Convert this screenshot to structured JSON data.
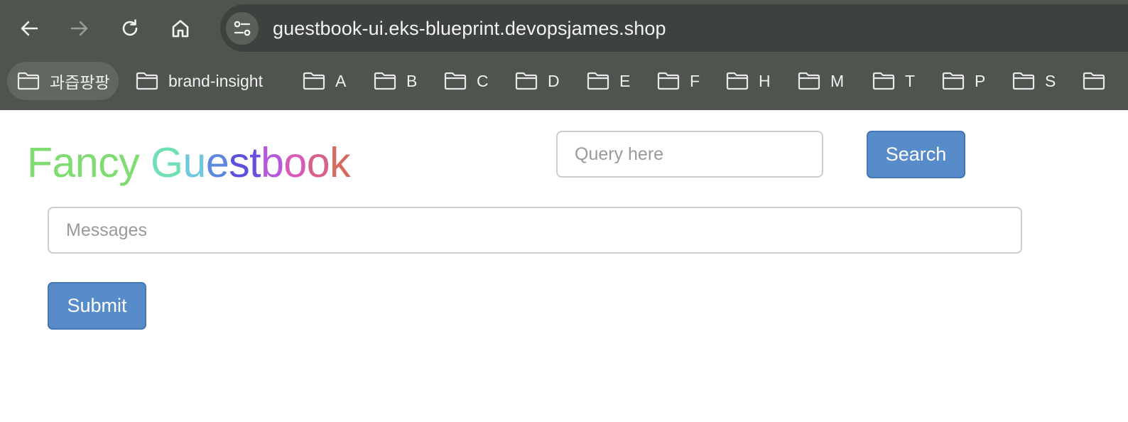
{
  "browser": {
    "url": "guestbook-ui.eks-blueprint.devopsjames.shop",
    "bookmarks": [
      {
        "label": "과즙팡팡"
      },
      {
        "label": "brand-insight"
      },
      {
        "label": "A"
      },
      {
        "label": "B"
      },
      {
        "label": "C"
      },
      {
        "label": "D"
      },
      {
        "label": "E"
      },
      {
        "label": "F"
      },
      {
        "label": "H"
      },
      {
        "label": "M"
      },
      {
        "label": "T"
      },
      {
        "label": "P"
      },
      {
        "label": "S"
      },
      {
        "label": ""
      }
    ],
    "icons": {
      "back": "back-arrow-icon",
      "forward": "forward-arrow-icon",
      "reload": "reload-icon",
      "home": "home-icon",
      "site_info": "tune-icon",
      "folder": "folder-icon"
    }
  },
  "page": {
    "title_letters": [
      {
        "ch": "F",
        "color": "#7fdc71"
      },
      {
        "ch": "a",
        "color": "#7fdc71"
      },
      {
        "ch": "n",
        "color": "#7fdc71"
      },
      {
        "ch": "c",
        "color": "#7fdc71"
      },
      {
        "ch": "y",
        "color": "#7fdc71"
      },
      {
        "ch": " ",
        "color": "#7fdc71"
      },
      {
        "ch": "G",
        "color": "#70dfb4"
      },
      {
        "ch": "u",
        "color": "#6fc9de"
      },
      {
        "ch": "e",
        "color": "#5e88de"
      },
      {
        "ch": "s",
        "color": "#5b52d9"
      },
      {
        "ch": "t",
        "color": "#6b4fdc"
      },
      {
        "ch": "b",
        "color": "#b65adb"
      },
      {
        "ch": "o",
        "color": "#d85ab6"
      },
      {
        "ch": "o",
        "color": "#d8618a"
      },
      {
        "ch": "k",
        "color": "#d66a5e"
      }
    ],
    "search": {
      "placeholder": "Query here",
      "button_label": "Search"
    },
    "message": {
      "placeholder": "Messages"
    },
    "submit_label": "Submit",
    "colors": {
      "button": "#578bc9",
      "chrome": "#4f544f"
    }
  }
}
